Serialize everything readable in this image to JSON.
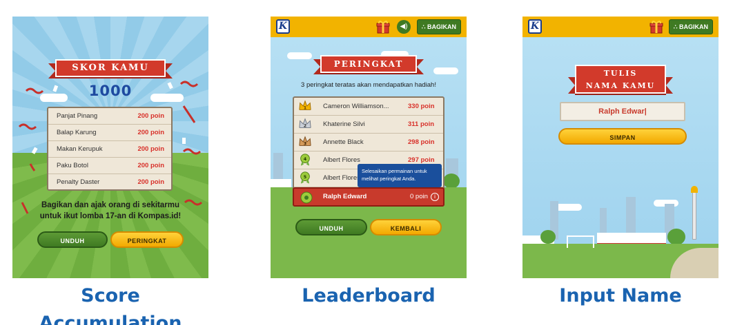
{
  "captions": {
    "score": "Score Accumulation",
    "leaderboard": "Leaderboard",
    "input": "Input Name"
  },
  "colors": {
    "caption": "#1a63b0",
    "banner_red": "#d23a2b",
    "topbar_yellow": "#f2b300",
    "button_green": "#3f7a22",
    "button_yellow": "#f2a900",
    "points_red": "#d8312a"
  },
  "score_screen": {
    "banner": "SKOR KAMU",
    "total": "1000",
    "items": [
      {
        "name": "Panjat Pinang",
        "points": "200 poin"
      },
      {
        "name": "Balap Karung",
        "points": "200 poin"
      },
      {
        "name": "Makan Kerupuk",
        "points": "200 poin"
      },
      {
        "name": "Paku Botol",
        "points": "200 poin"
      },
      {
        "name": "Penalty Daster",
        "points": "200 poin"
      }
    ],
    "share_text": "Bagikan dan ajak orang di sekitarmu untuk ikut lomba 17-an di Kompas.id!",
    "btn_download": "UNDUH",
    "btn_rank": "PERINGKAT"
  },
  "leaderboard_screen": {
    "logo": "K",
    "share_label": "BAGIKAN",
    "banner": "PERINGKAT",
    "subtitle": "3 peringkat teratas akan mendapatkan hadiah!",
    "rows": [
      {
        "rank": "1",
        "name": "Cameron Williamson...",
        "points": "330 poin",
        "medal": "crown-gold"
      },
      {
        "rank": "2",
        "name": "Khaterine Silvi",
        "points": "311 poin",
        "medal": "crown-silver"
      },
      {
        "rank": "3",
        "name": "Annette Black",
        "points": "298 poin",
        "medal": "crown-bronze"
      },
      {
        "rank": "4",
        "name": "Albert Flores",
        "points": "297 poin",
        "medal": "ribbon-green"
      },
      {
        "rank": "5",
        "name": "Albert Flores",
        "points": "",
        "medal": "ribbon-green"
      }
    ],
    "current_user": {
      "name": "Ralph Edward",
      "points": "0 poin"
    },
    "tooltip": "Selesaikan permainan untuk melihat peringkat Anda.",
    "btn_download": "UNDUH",
    "btn_back": "KEMBALI"
  },
  "input_screen": {
    "logo": "K",
    "share_label": "BAGIKAN",
    "banner_line1": "TULIS",
    "banner_line2": "NAMA KAMU",
    "name_value": "Ralph Edwar|",
    "btn_save": "SIMPAN"
  }
}
